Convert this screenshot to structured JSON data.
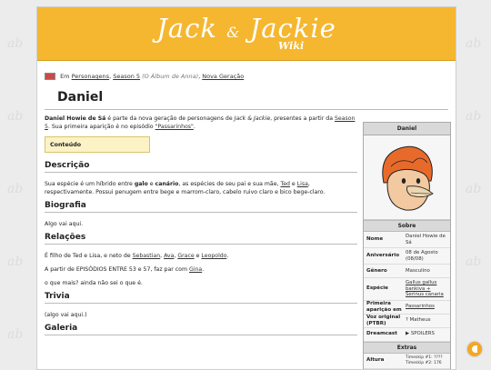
{
  "site": {
    "logo_main": "Jack",
    "logo_amp": "&",
    "logo_second": "Jackie",
    "logo_sub": "Wiki"
  },
  "breadcrumb": {
    "prefix": "Em",
    "links": [
      "Personagens",
      "Season 5",
      "(O Álbum de Anna)",
      "Nova Geração"
    ]
  },
  "page_title": "Daniel",
  "intro": {
    "name": "Daniel Howie de Sá",
    "t1": " é parte da nova geração de personagens de ",
    "show": "Jack & Jackie",
    "t2": ", presentes a partir da ",
    "season_link": "Season 5",
    "t3": ". Sua primeira aparição é no episódio ",
    "episode_link": "\"Passarinhos\"",
    "t4": "."
  },
  "toc_label": "Conteúdo",
  "sections": {
    "descricao": {
      "heading": "Descrição",
      "t1": "Sua espécie é um híbrido entre ",
      "b1": "galo",
      "t2": " e ",
      "b2": "canário",
      "t3": ", as espécies de seu pai e sua mãe, ",
      "l1": "Ted",
      "t4": " e ",
      "l2": "Lisa",
      "t5": ", respectivamente. Possui penugem entre bege e marrom-claro, cabelo ruivo claro e bico bege-claro."
    },
    "biografia": {
      "heading": "Biografia",
      "text": "Algo vai aqui."
    },
    "relacoes": {
      "heading": "Relações",
      "p1_text": "É filho de Ted e Lisa, e neto de ",
      "p1_links": [
        "Sebastian",
        "Ava",
        "Grace",
        "Leopoldo"
      ],
      "p1_sep1": ", ",
      "p1_sep2": ", ",
      "p1_sep3": " e ",
      "p1_end": ".",
      "p2_text": "A partir de EPISÓDIOS ENTRE 53 e 57, faz par com ",
      "p2_link": "Gina",
      "p2_end": ".",
      "p3": "o que mais? ainda não sei o que é."
    },
    "trivia": {
      "heading": "Trivia",
      "text": "(algo vai aqui.)"
    },
    "galeria": {
      "heading": "Galeria"
    }
  },
  "infobox": {
    "title": "Daniel",
    "sobre_heading": "Sobre",
    "rows": [
      {
        "key": "Nome",
        "value": "Daniel Howie de Sá"
      },
      {
        "key": "Aniversário",
        "value": "08 de Agosto (08/08)"
      },
      {
        "key": "Gênero",
        "value": "Masculino"
      },
      {
        "key": "Espécie",
        "value": "Gallus gallus bankiva + Serinus canaria"
      },
      {
        "key": "Primeira aparição em",
        "value": "Passarinhos"
      },
      {
        "key": "Voz original (PTBR)",
        "value": "? Matheus"
      },
      {
        "key": "Dreamcast",
        "value": "▶ SPOILERS"
      }
    ],
    "extras_heading": "Extras",
    "altura_key": "Altura",
    "altura_values": [
      "Timeskip #1: ????",
      "Timeskip #2: 176"
    ]
  }
}
